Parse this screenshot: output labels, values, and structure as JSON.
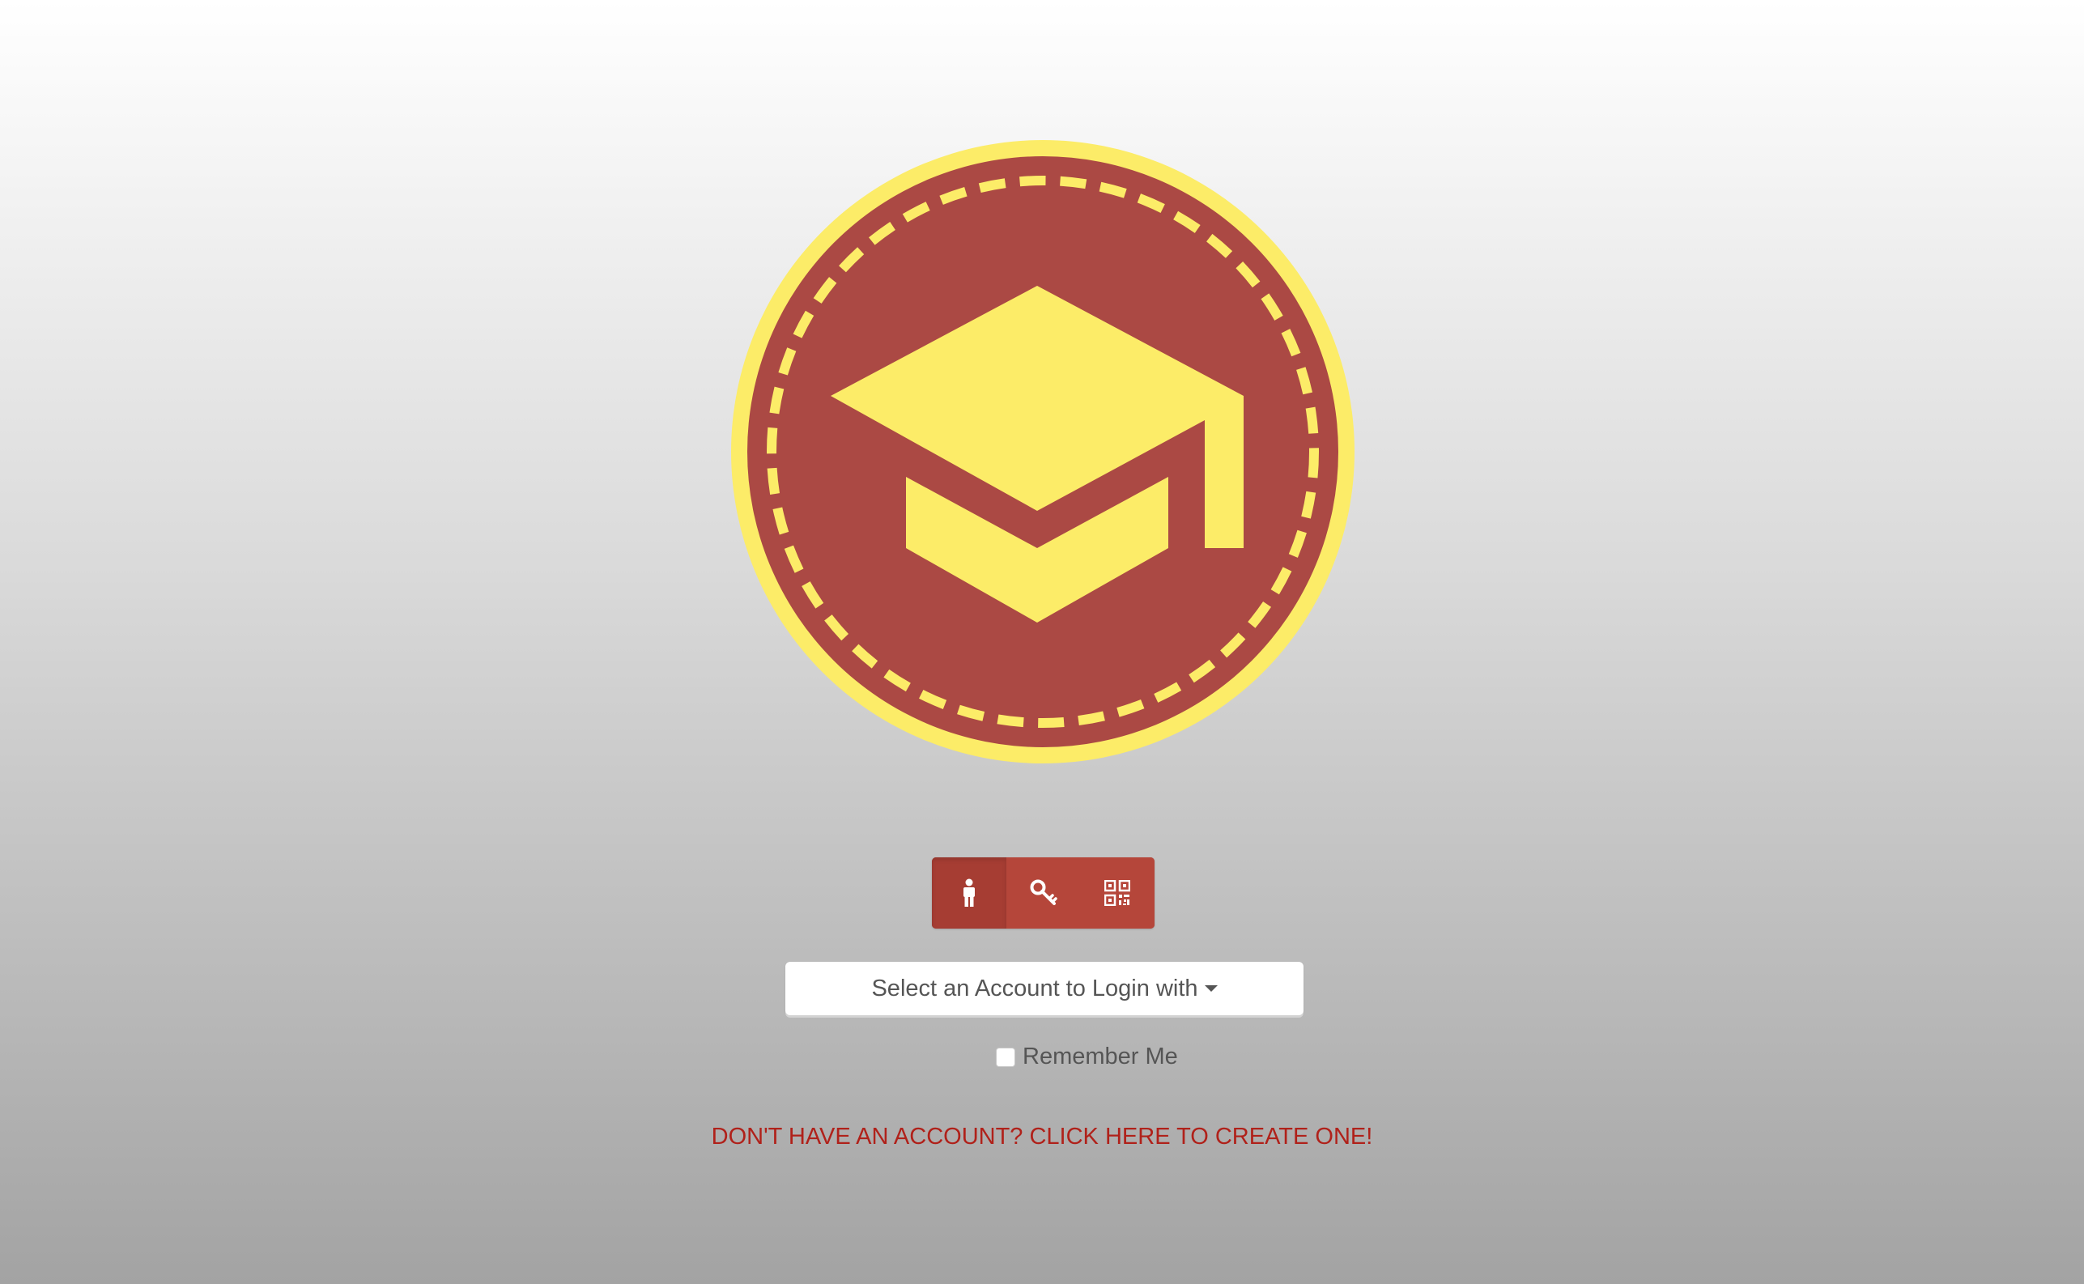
{
  "logo": {
    "icon": "graduation-cap-icon",
    "outer_color": "#fcec68",
    "inner_color": "#ab4944"
  },
  "login_modes": [
    {
      "name": "user",
      "icon": "person-icon",
      "active": true
    },
    {
      "name": "key",
      "icon": "key-icon",
      "active": false
    },
    {
      "name": "qr",
      "icon": "qr-code-icon",
      "active": false
    }
  ],
  "account_select": {
    "label": "Select an Account to Login with"
  },
  "remember_me": {
    "label": "Remember Me",
    "checked": false
  },
  "create_account": {
    "label": "DON'T HAVE AN ACCOUNT? CLICK HERE TO CREATE ONE!"
  },
  "colors": {
    "accent": "#b5463a",
    "link": "#b0211a",
    "text": "#555555"
  }
}
